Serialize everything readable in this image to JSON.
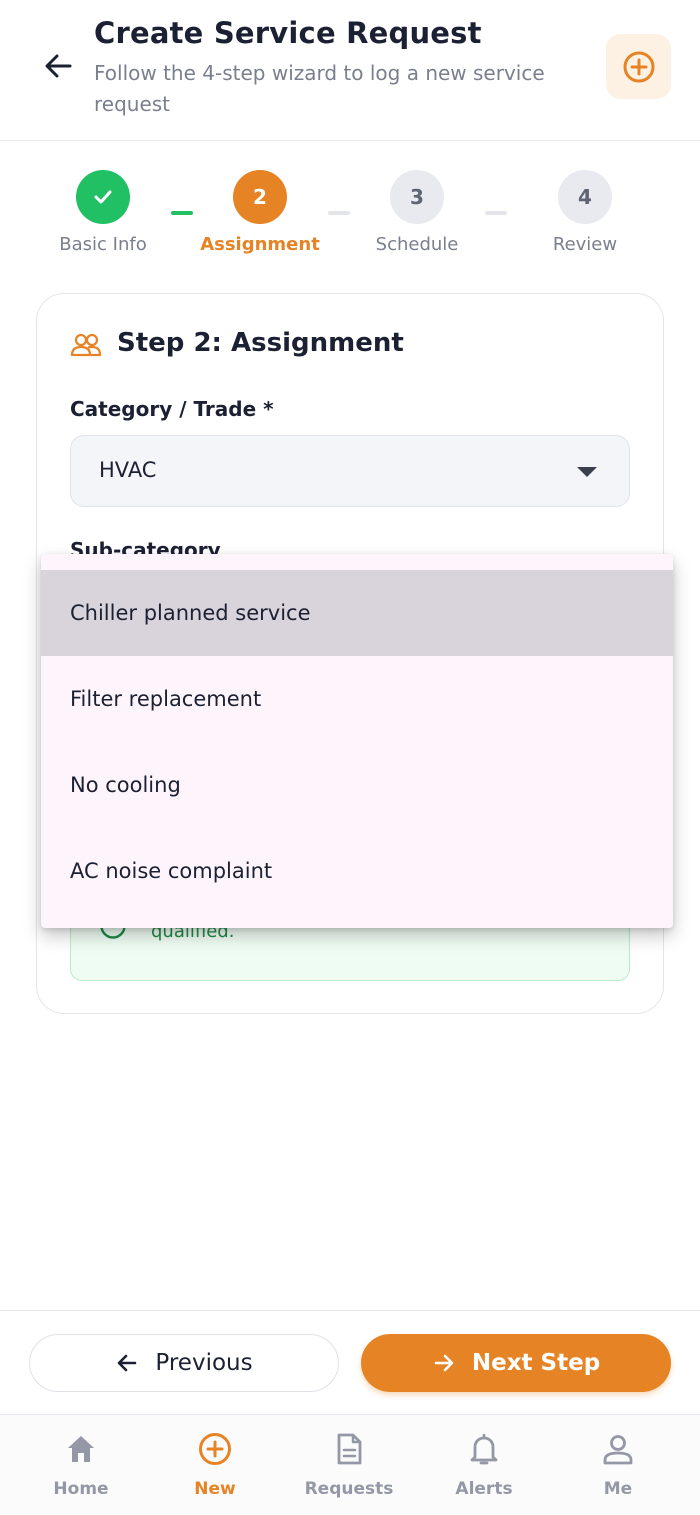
{
  "header": {
    "title": "Create Service Request",
    "subtitle": "Follow the 4-step wizard to log a new service request"
  },
  "stepper": {
    "steps": [
      {
        "number": "1",
        "label": "Basic Info",
        "state": "done"
      },
      {
        "number": "2",
        "label": "Assignment",
        "state": "active"
      },
      {
        "number": "3",
        "label": "Schedule",
        "state": "todo"
      },
      {
        "number": "4",
        "label": "Review",
        "state": "todo"
      }
    ]
  },
  "card": {
    "title": "Step 2: Assignment",
    "category_label": "Category / Trade *",
    "category_value": "HVAC",
    "subcategory_label": "Sub-category",
    "info_text": "qualified."
  },
  "dropdown": {
    "options": [
      "Chiller planned service",
      "Filter replacement",
      "No cooling",
      "AC noise complaint"
    ],
    "highlighted_index": 0
  },
  "actions": {
    "previous_label": "Previous",
    "next_label": "Next Step"
  },
  "nav": {
    "items": [
      {
        "label": "Home",
        "icon": "home-icon"
      },
      {
        "label": "New",
        "icon": "plus-circle-icon",
        "active": true
      },
      {
        "label": "Requests",
        "icon": "document-icon"
      },
      {
        "label": "Alerts",
        "icon": "bell-icon"
      },
      {
        "label": "Me",
        "icon": "user-icon"
      }
    ]
  },
  "colors": {
    "accent": "#e68425",
    "success": "#22c065",
    "text": "#1c2033",
    "muted": "#7a7f8e"
  }
}
